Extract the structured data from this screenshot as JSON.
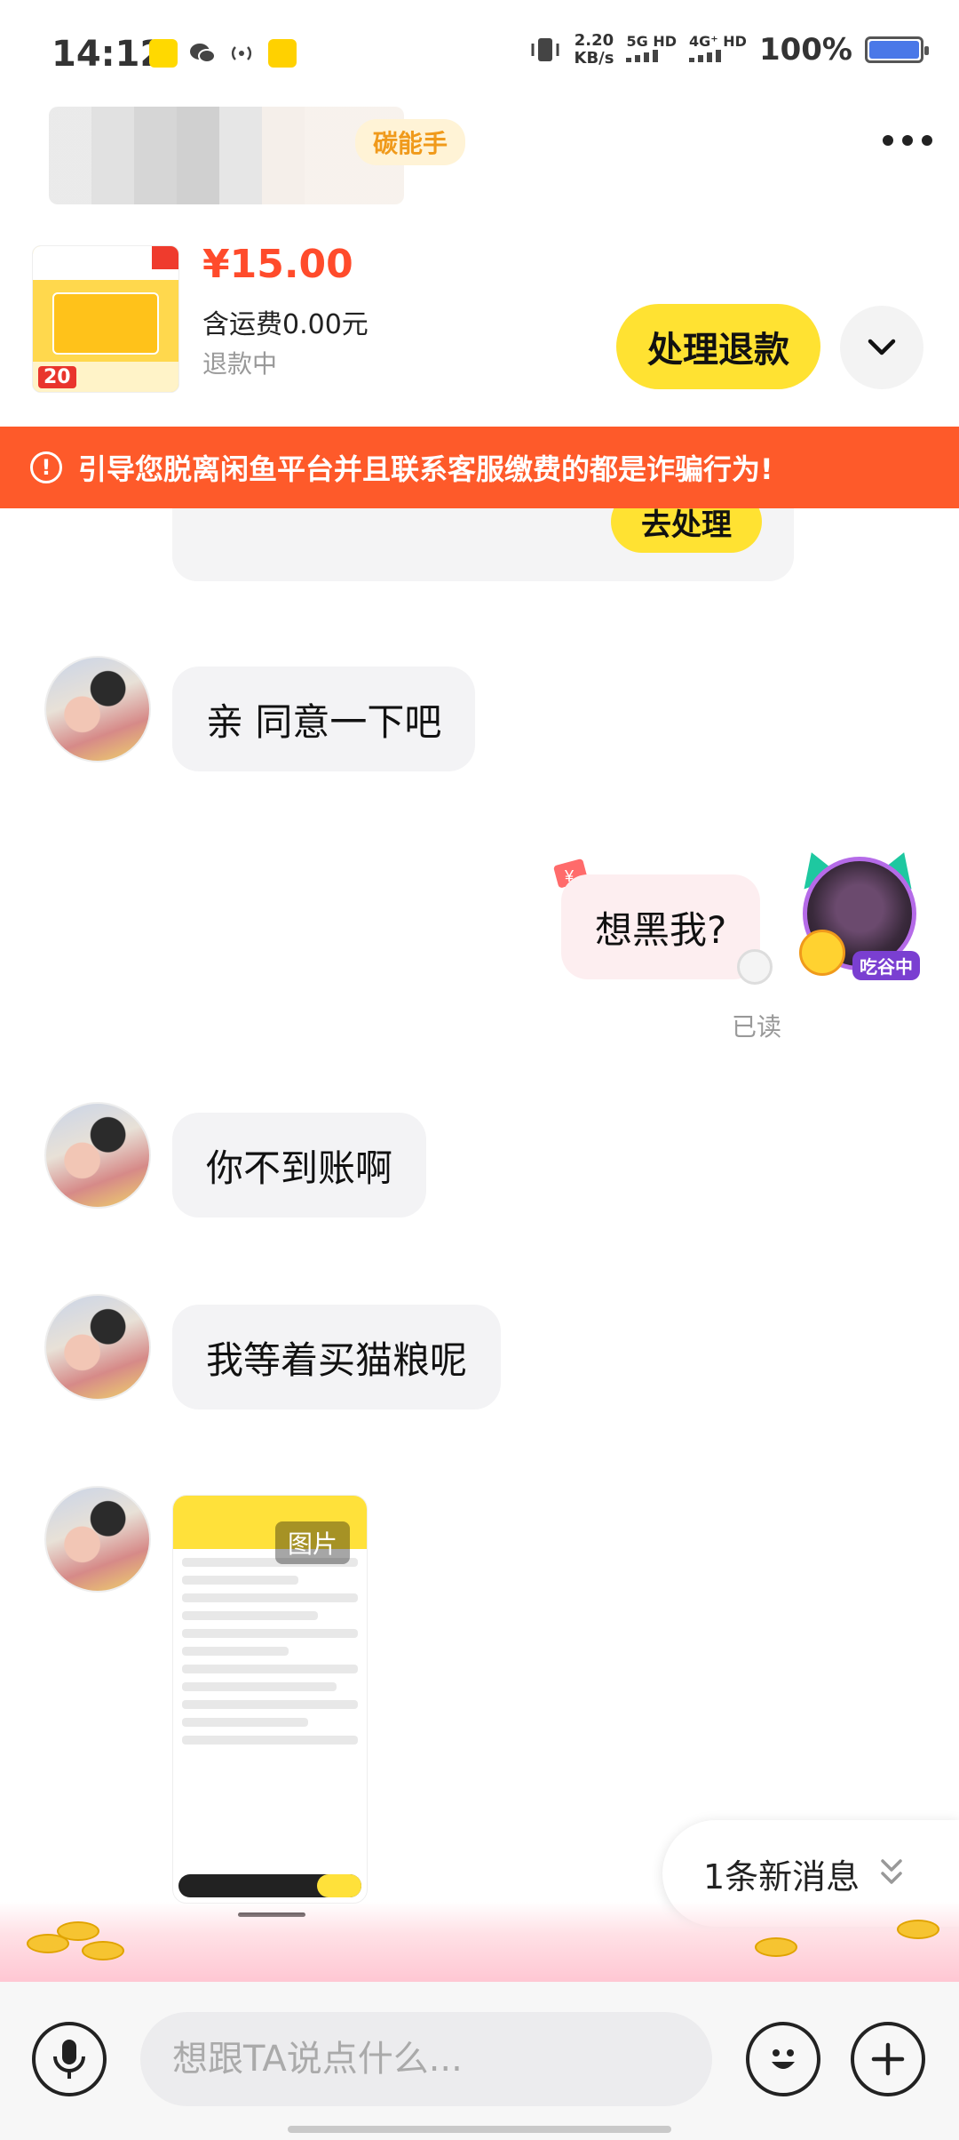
{
  "status_bar": {
    "time": "14:12",
    "app_icons": [
      "xianyu-icon",
      "wechat-icon",
      "hotspot-icon",
      "meituan-icon"
    ],
    "net_speed_value": "2.20",
    "net_speed_unit": "KB/s",
    "sim1": "5G HD",
    "sim2": "4G⁺ HD",
    "battery": "100%",
    "battery_level": 1.0
  },
  "header": {
    "badge": "碳能手",
    "more_icon": "more-horizontal-icon"
  },
  "order": {
    "price": "¥15.00",
    "shipping": "含运费0.00元",
    "status": "退款中",
    "refund_button": "处理退款",
    "thumb_tag": "20",
    "expand_icon": "chevron-down-icon"
  },
  "warning": {
    "text": "引导您脱离闲鱼平台并且联系客服缴费的都是诈骗行为!"
  },
  "chat": {
    "prev_button": "去处理",
    "messages": [
      {
        "from": "other",
        "text": "亲 同意一下吧"
      },
      {
        "from": "me",
        "text": "想黑我?",
        "read": "已读",
        "avatar_tag": "吃谷中"
      },
      {
        "from": "other",
        "text": "你不到账啊"
      },
      {
        "from": "other",
        "text": "我等着买猫粮呢"
      },
      {
        "from": "other",
        "type": "image",
        "label": "图片"
      }
    ],
    "new_messages": "1条新消息"
  },
  "input": {
    "placeholder": "想跟TA说点什么...",
    "voice_icon": "microphone-icon",
    "emoji_icon": "emoji-icon",
    "plus_icon": "plus-icon"
  },
  "colors": {
    "accent_yellow": "#ffe232",
    "price_red": "#ff4b2b",
    "warning_orange": "#fe5a2a"
  }
}
